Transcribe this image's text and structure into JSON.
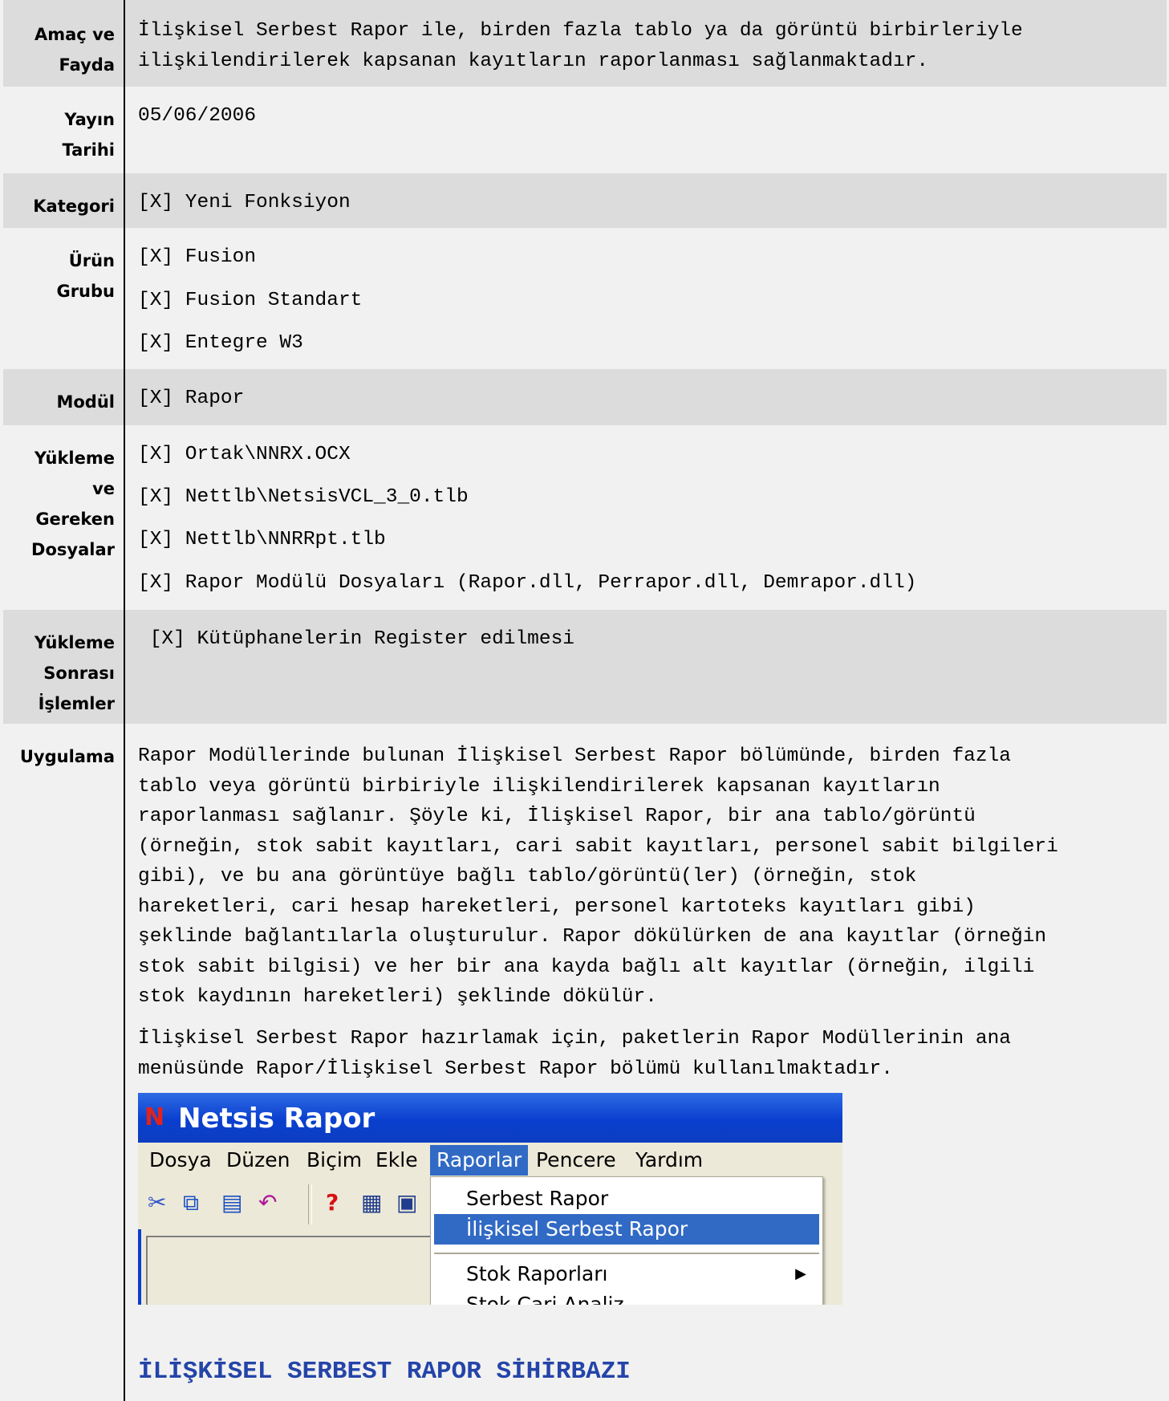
{
  "rows": {
    "amac": {
      "label": [
        "Amaç ve",
        "Fayda"
      ],
      "text": "İlişkisel Serbest Rapor ile, birden fazla tablo ya da görüntü birbirleriyle\nilişkilendirilerek kapsanan kayıtların raporlanması sağlanmaktadır."
    },
    "yayin": {
      "label": [
        "Yayın",
        "Tarihi"
      ],
      "value": "05/06/2006"
    },
    "kategori": {
      "label": [
        "Kategori"
      ],
      "value": "[X] Yeni Fonksiyon"
    },
    "urun": {
      "label": [
        "Ürün",
        "Grubu"
      ],
      "items": [
        "[X] Fusion",
        "[X] Fusion Standart",
        "[X] Entegre W3"
      ]
    },
    "modul": {
      "label": [
        "Modül"
      ],
      "value": "[X] Rapor"
    },
    "yukleme": {
      "label": [
        "Yükleme",
        "ve",
        "Gereken",
        "Dosyalar"
      ],
      "items": [
        "[X] Ortak\\NNRX.OCX",
        "[X] Nettlb\\NetsisVCL_3_0.tlb",
        "[X] Nettlb\\NNRRpt.tlb",
        "[X] Rapor Modülü Dosyaları (Rapor.dll, Perrapor.dll, Demrapor.dll)"
      ]
    },
    "sonrasi": {
      "label": [
        "Yükleme",
        "Sonrası",
        "İşlemler"
      ],
      "value": " [X] Kütüphanelerin Register edilmesi"
    },
    "uygulama": {
      "label": [
        "Uygulama"
      ],
      "para1": "Rapor Modüllerinde bulunan İlişkisel Serbest Rapor bölümünde, birden fazla\ntablo veya görüntü birbiriyle ilişkilendirilerek kapsanan kayıtların\nraporlanması sağlanır. Şöyle ki, İlişkisel Rapor, bir ana tablo/görüntü\n(örneğin, stok sabit kayıtları, cari sabit kayıtları, personel sabit bilgileri\ngibi), ve bu ana görüntüye bağlı tablo/görüntü(ler) (örneğin, stok\nhareketleri, cari hesap hareketleri, personel kartoteks kayıtları gibi)\nşeklinde bağlantılarla oluşturulur. Rapor dökülürken de ana kayıtlar (örneğin\nstok sabit bilgisi) ve her bir ana kayda bağlı alt kayıtlar (örneğin, ilgili\nstok kaydının hareketleri) şeklinde dökülür.",
      "para2": "İlişkisel Serbest Rapor hazırlamak için, paketlerin Rapor Modüllerinin ana\nmenüsünde Rapor/İlişkisel Serbest Rapor bölümü kullanılmaktadır."
    }
  },
  "screenshot": {
    "logo": "N",
    "title": "Netsis Rapor",
    "menu": [
      "Dosya",
      "Düzen",
      "Biçim",
      "Ekle",
      "Raporlar",
      "Pencere",
      "Yardım"
    ],
    "dropdown": [
      "Serbest Rapor",
      "İlişkisel Serbest Rapor",
      "Stok Raporları",
      "Stok Cari Analiz"
    ],
    "accent": "#316ac5"
  },
  "heading": "İLİŞKİSEL SERBEST RAPOR SİHİRBAZI"
}
